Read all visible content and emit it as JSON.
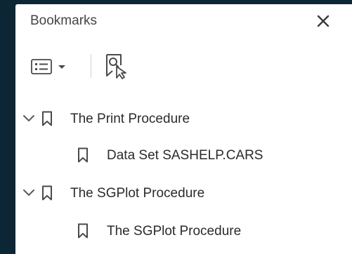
{
  "panel": {
    "title": "Bookmarks",
    "close_icon": "close-icon"
  },
  "toolbar": {
    "options_icon": "bookmark-options-icon",
    "options_dropdown_icon": "chevron-down-icon",
    "find_icon": "find-current-bookmark-icon"
  },
  "bookmarks": [
    {
      "label": "The Print Procedure",
      "expanded": true,
      "children": [
        {
          "label": "Data Set SASHELP.CARS"
        }
      ]
    },
    {
      "label": "The SGPlot Procedure",
      "expanded": true,
      "children": [
        {
          "label": "The SGPlot Procedure"
        }
      ]
    }
  ]
}
